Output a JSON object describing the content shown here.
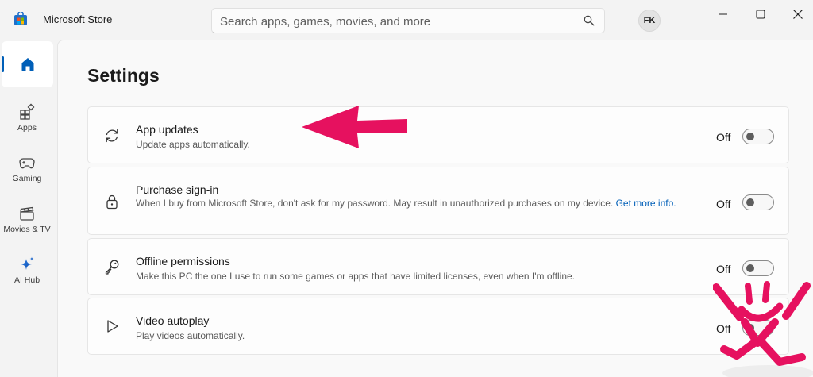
{
  "app": {
    "title": "Microsoft Store",
    "logo_icon": "microsoft-store-icon"
  },
  "search": {
    "placeholder": "Search apps, games, movies, and more",
    "value": "",
    "icon": "search-icon"
  },
  "account": {
    "initials": "FK"
  },
  "window_controls": [
    "minimize-icon",
    "maximize-icon",
    "close-icon"
  ],
  "sidebar": {
    "items": [
      {
        "label": "",
        "icon": "home-icon",
        "selected": true
      },
      {
        "label": "Apps",
        "icon": "apps-icon",
        "selected": false
      },
      {
        "label": "Gaming",
        "icon": "gamepad-icon",
        "selected": false
      },
      {
        "label": "Movies & TV",
        "icon": "clapperboard-icon",
        "selected": false
      },
      {
        "label": "AI Hub",
        "icon": "sparkle-icon",
        "selected": false
      }
    ]
  },
  "page": {
    "title": "Settings"
  },
  "settings": [
    {
      "title": "App updates",
      "description": "Update apps automatically.",
      "icon": "refresh-icon",
      "state_label": "Off",
      "enabled": false
    },
    {
      "title": "Purchase sign-in",
      "description": "When I buy from Microsoft Store, don't ask for my password. May result in unauthorized purchases on my device.",
      "link": "Get more info.",
      "icon": "lock-icon",
      "state_label": "Off",
      "enabled": false
    },
    {
      "title": "Offline permissions",
      "description": "Make this PC the one I use to run some games or apps that have limited licenses, even when I'm offline.",
      "icon": "key-icon",
      "state_label": "Off",
      "enabled": false
    },
    {
      "title": "Video autoplay",
      "description": "Play videos automatically.",
      "icon": "play-icon",
      "state_label": "Off",
      "enabled": false
    }
  ],
  "colors": {
    "accent": "#005fb8",
    "annotation": "#e6115f"
  },
  "annotations": {
    "arrow": "red-arrow-icon",
    "mascot": "cheering-mascot-logo"
  }
}
